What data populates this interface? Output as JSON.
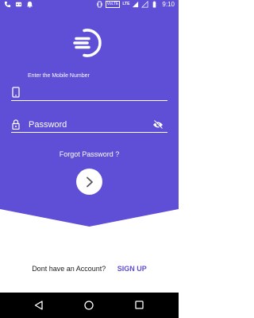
{
  "status_bar": {
    "time": "9:10",
    "volte": "VoLTE",
    "network": "LTE",
    "icons": [
      "phone-icon",
      "media-icon",
      "notification-icon",
      "vibrate-icon",
      "signal-icon",
      "battery-icon"
    ]
  },
  "login": {
    "mobile_label": "Enter the Mobile Number",
    "mobile_value": "",
    "password_placeholder": "Password",
    "forgot_label": "Forgot Password ?"
  },
  "footer": {
    "signup_prompt": "Dont have an Account?",
    "signup_label": "SIGN UP"
  },
  "colors": {
    "primary": "#5f4fd6",
    "text_dark": "#222222"
  }
}
